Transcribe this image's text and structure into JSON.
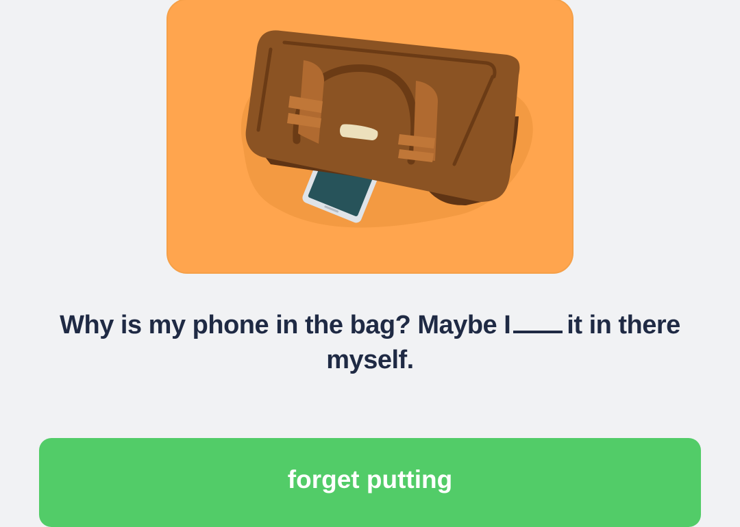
{
  "illustration": {
    "icon": "bag-with-phone-icon",
    "background_color": "#ffa54e"
  },
  "question": {
    "before_blank": "Why is my phone in the bag? Maybe I",
    "after_blank": "it in there myself."
  },
  "answer_option": {
    "label": "forget putting",
    "color": "#52cc68"
  }
}
